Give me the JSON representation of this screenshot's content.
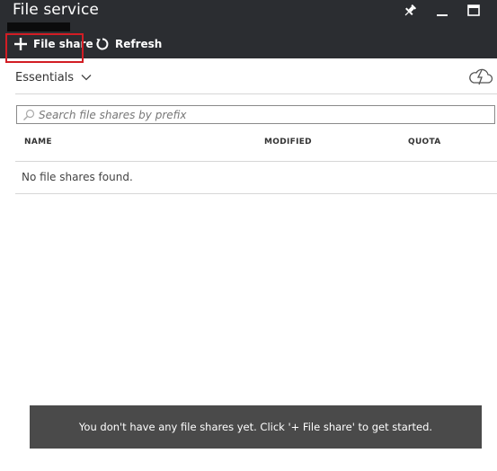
{
  "window": {
    "title": "File service",
    "controls": [
      "pin-icon",
      "minimize-icon",
      "maximize-icon"
    ]
  },
  "toolbar": {
    "add_label": "File share",
    "refresh_label": "Refresh"
  },
  "essentials": {
    "label": "Essentials"
  },
  "search": {
    "placeholder": "Search file shares by prefix",
    "value": ""
  },
  "table": {
    "columns": [
      "NAME",
      "MODIFIED",
      "QUOTA"
    ],
    "rows": [],
    "empty_text": "No file shares found."
  },
  "notice": {
    "text": "You don't have any file shares yet. Click '+ File share' to get started."
  },
  "colors": {
    "header_bg": "#2b2d31",
    "highlight": "#d21d24",
    "notice_bg": "#4a4a4a"
  }
}
